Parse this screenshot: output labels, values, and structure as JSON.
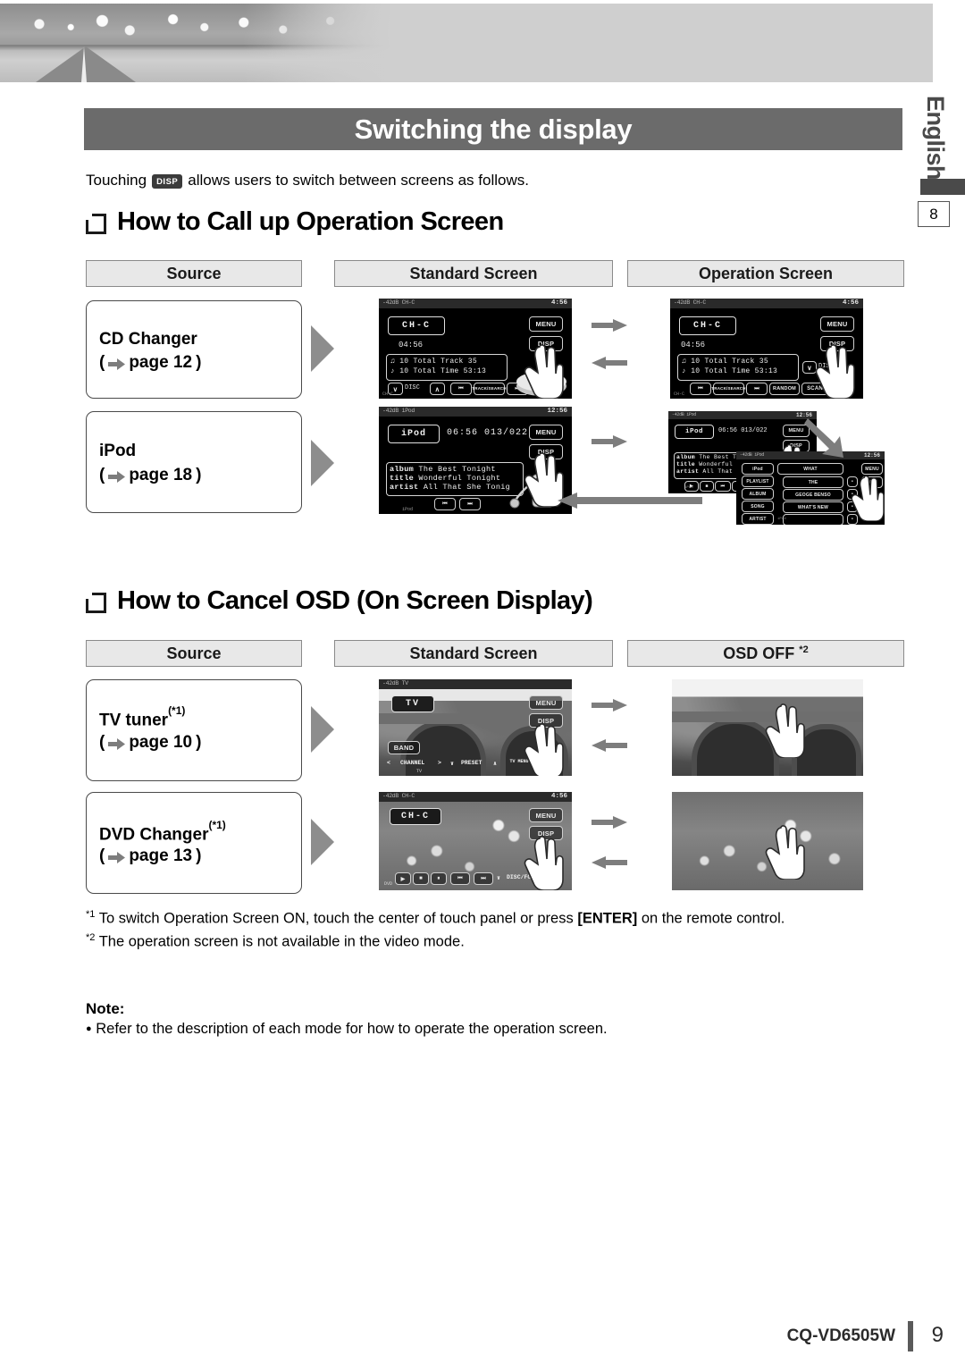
{
  "document": {
    "language_tab": "English",
    "chapter_number": "8",
    "title": "Switching the display",
    "intro_prefix": "Touching",
    "intro_chip": "DISP",
    "intro_suffix": "allows users to switch between screens as follows.",
    "footer_model": "CQ-VD6505W",
    "footer_page": "9"
  },
  "sections": [
    {
      "heading": "How to Call up Operation Screen",
      "columns": [
        "Source",
        "Standard Screen",
        "Operation Screen"
      ],
      "rows": [
        {
          "source_label": "CD Changer",
          "source_page": "page 12",
          "source_page_prefix": "(",
          "source_page_suffix": ")"
        },
        {
          "source_label": "iPod",
          "source_page": "page 18",
          "source_page_prefix": "(",
          "source_page_suffix": ")"
        }
      ]
    },
    {
      "heading": "How to Cancel OSD (On Screen Display)",
      "columns": [
        "Source",
        "Standard Screen",
        "OSD OFF"
      ],
      "osd_footnote_marker": "*2",
      "rows": [
        {
          "source_label": "TV tuner",
          "source_marker": "(*1)",
          "source_page": "page 10",
          "source_page_prefix": "(",
          "source_page_suffix": ")"
        },
        {
          "source_label": "DVD Changer",
          "source_marker": "(*1)",
          "source_page": "page 13",
          "source_page_prefix": "(",
          "source_page_suffix": ")"
        }
      ]
    }
  ],
  "screens": {
    "cd_standard": {
      "source_id": "-42dB CH-C",
      "clock": "4:56",
      "mode": "CH-C",
      "elapsed": "04:56",
      "menu_button": "MENU",
      "disp_button": "DISP",
      "info": [
        {
          "icon": "disc",
          "num": "10",
          "label": "Total Track",
          "value": "35"
        },
        {
          "icon": "note",
          "num": "10",
          "label": "Total Time",
          "value": "53:13"
        }
      ],
      "controls": [
        "∨",
        "DISC",
        "∧",
        "⏮",
        "TRACK/SEARCH",
        "⏭"
      ],
      "footer": "CH-C"
    },
    "cd_operation": {
      "source_id": "-42dB CH-C",
      "clock": "4:56",
      "mode": "CH-C",
      "elapsed": "04:56",
      "menu_button": "MENU",
      "disp_button": "DISP",
      "info": [
        {
          "icon": "disc",
          "num": "10",
          "label": "Total Track",
          "value": "35"
        },
        {
          "icon": "note",
          "num": "10",
          "label": "Total Time",
          "value": "53:13"
        }
      ],
      "controls": [
        "∨",
        "DISC",
        "⏮",
        "TRACK/SEARCH",
        "⏭",
        "RANDOM",
        "SCAN",
        "REP"
      ],
      "footer": "CH-C"
    },
    "ipod_standard": {
      "source_id": "-42dB iPod",
      "clock": "12:56",
      "mode": "iPod",
      "time": "06:56  013/022",
      "menu_button": "MENU",
      "disp_button": "DISP",
      "info": [
        {
          "label": "album",
          "value": "The Best  Tonight"
        },
        {
          "label": "title",
          "value": "Wonderful Tonight"
        },
        {
          "label": "artist",
          "value": "All That She Tonig"
        }
      ],
      "controls": [
        "⏮",
        "⏭"
      ],
      "footer": "iPod"
    },
    "ipod_operation_1": {
      "source_id": "-42dB iPod",
      "clock": "12:56",
      "mode": "iPod",
      "time": "06:56  013/022",
      "menu_button": "MENU",
      "disp_button": "DISP",
      "info": [
        {
          "label": "album",
          "value": "The Best  Tonight"
        },
        {
          "label": "title",
          "value": "Wonderful Tonight"
        },
        {
          "label": "artist",
          "value": "All That She Tonig"
        }
      ],
      "controls": [
        "▶",
        "■",
        "⏮",
        "⏭"
      ],
      "footer": "iPod"
    },
    "ipod_operation_2": {
      "source_id": "-42dB iPod",
      "clock": "12:56",
      "menu_button": "MENU",
      "disp_button": "DISP",
      "left_menu": [
        "iPod",
        "PLAYLIST",
        "ALBUM",
        "SONG",
        "ARTIST"
      ],
      "list_header": "WHAT",
      "list_items": [
        "THE",
        "GEOGE BENSO",
        "WHAT'S NEW",
        ""
      ],
      "footer": "iPod"
    },
    "tv_standard": {
      "source_id": "-42dB TV",
      "mode": "TV",
      "menu_button": "MENU",
      "disp_button": "DISP",
      "band_button": "BAND",
      "controls": [
        "<",
        "CHANNEL",
        ">",
        "∨",
        "PRESET",
        "∧",
        "TV MENU"
      ],
      "footer": "TV"
    },
    "tv_osd_off": {
      "caption": ""
    },
    "dvd_standard": {
      "source_id": "-42dB CH-C",
      "clock": "4:56",
      "mode": "CH-C",
      "menu_button": "MENU",
      "disp_button": "DISP",
      "controls": [
        "▶",
        "■",
        "⏸",
        "⏮",
        "⏭",
        "∨",
        "DISC/FOLDER",
        "∧"
      ],
      "footer": "DVD"
    },
    "dvd_osd_off": {
      "caption": ""
    }
  },
  "footnotes": [
    {
      "marker": "*1",
      "text_before": "To switch Operation Screen ON,  touch the center of touch panel or press ",
      "bold": "[ENTER]",
      "text_after": " on the remote control."
    },
    {
      "marker": "*2",
      "text_before": "The operation screen is not available in the video mode.",
      "bold": "",
      "text_after": ""
    }
  ],
  "note": {
    "heading": "Note:",
    "bullet": "●",
    "items": [
      "Refer to the description of each mode for how to operate the operation screen."
    ]
  }
}
